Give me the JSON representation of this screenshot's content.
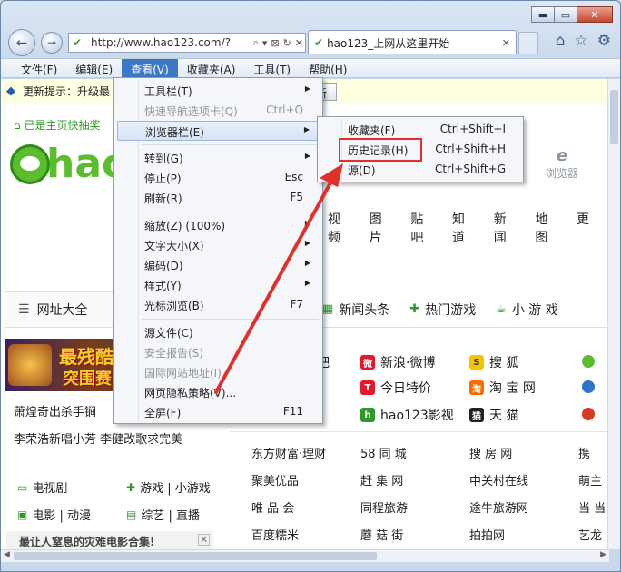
{
  "window": {
    "minimize": "▬",
    "maximize": "▭",
    "close": "✕"
  },
  "nav": {
    "url": "http://www.hao123.com/?",
    "address_controls": [
      "⌕",
      "▾",
      "⊠",
      "↻",
      "✕"
    ],
    "tab_title": "hao123_上网从这里开始",
    "tab_close": "✕",
    "right_icons": [
      "home-icon",
      "favorites-star-icon",
      "tools-gear-icon"
    ]
  },
  "menubar": {
    "items": [
      "文件(F)",
      "编辑(E)",
      "查看(V)",
      "收藏夹(A)",
      "工具(T)",
      "帮助(H)"
    ],
    "active_index": 2
  },
  "infobar": {
    "message": "更新提示：升级最",
    "button": "新"
  },
  "page": {
    "home_link": "已是主页快抽奖",
    "logo_text": "hao",
    "browser_label": "浏览器",
    "browser_glyph": "e",
    "search_tabs": [
      "视频",
      "图片",
      "贴吧",
      "知道",
      "新闻",
      "地图",
      "更"
    ],
    "category_bar": "网址大全",
    "top_tabs": [
      "新闻头条",
      "热门游戏",
      "小 游 戏"
    ],
    "game_banner": [
      "最残酷",
      "突围赛"
    ],
    "news_lines": [
      "萧煌奇出杀手锏",
      "李荣浩新唱小芳  李健改歌求完美"
    ],
    "left_categories": [
      "电视剧",
      "游戏 | 小游戏",
      "电影 | 动漫",
      "综艺 | 直播"
    ],
    "promo": "最让人窒息的灾难电影合集!",
    "promo_close": "✕",
    "sites_col1": [
      "吧"
    ],
    "sites_col2": [
      "新浪·微博",
      "今日特价",
      "hao123影视"
    ],
    "sites_col3": [
      "搜 狐",
      "淘 宝 网",
      "天 猫"
    ],
    "low_grid": [
      [
        "东方财富·理财",
        "58 同 城",
        "搜 房 网",
        "携"
      ],
      [
        "聚美优品",
        "赶 集 网",
        "中关村在线",
        "萌主"
      ],
      [
        "唯 品 会",
        "同程旅游",
        "途牛旅游网",
        "当 当"
      ],
      [
        "百度糯米",
        "蘑 菇 街",
        "拍拍网",
        "艺龙"
      ]
    ]
  },
  "view_menu": {
    "items": [
      {
        "label": "工具栏(T)",
        "key": "",
        "submenu": true,
        "disabled": false
      },
      {
        "label": "快速导航选项卡(Q)",
        "key": "Ctrl+Q",
        "submenu": false,
        "disabled": true
      },
      {
        "label": "浏览器栏(E)",
        "key": "",
        "submenu": true,
        "disabled": false,
        "highlight": true
      },
      {
        "label": "转到(G)",
        "key": "",
        "submenu": true,
        "disabled": false
      },
      {
        "label": "停止(P)",
        "key": "Esc",
        "submenu": false,
        "disabled": false
      },
      {
        "label": "刷新(R)",
        "key": "F5",
        "submenu": false,
        "disabled": false
      },
      {
        "label": "缩放(Z) (100%)",
        "key": "",
        "submenu": true,
        "disabled": false
      },
      {
        "label": "文字大小(X)",
        "key": "",
        "submenu": true,
        "disabled": false
      },
      {
        "label": "编码(D)",
        "key": "",
        "submenu": true,
        "disabled": false
      },
      {
        "label": "样式(Y)",
        "key": "",
        "submenu": true,
        "disabled": false
      },
      {
        "label": "光标浏览(B)",
        "key": "F7",
        "submenu": false,
        "disabled": false
      },
      {
        "label": "源文件(C)",
        "key": "",
        "submenu": false,
        "disabled": false
      },
      {
        "label": "安全报告(S)",
        "key": "",
        "submenu": false,
        "disabled": true
      },
      {
        "label": "国际网站地址(I)",
        "key": "",
        "submenu": false,
        "disabled": true
      },
      {
        "label": "网页隐私策略(V)...",
        "key": "",
        "submenu": false,
        "disabled": false
      },
      {
        "label": "全屏(F)",
        "key": "F11",
        "submenu": false,
        "disabled": false
      }
    ]
  },
  "explorer_bar_menu": {
    "items": [
      {
        "label": "收藏夹(F)",
        "key": "Ctrl+Shift+I"
      },
      {
        "label": "历史记录(H)",
        "key": "Ctrl+Shift+H",
        "emphasized": true
      },
      {
        "label": "源(D)",
        "key": "Ctrl+Shift+G"
      }
    ]
  },
  "colors": {
    "menu_active": "#3c78c6",
    "annotation_red": "#e0302d",
    "brand_green": "#5bbd2e"
  }
}
